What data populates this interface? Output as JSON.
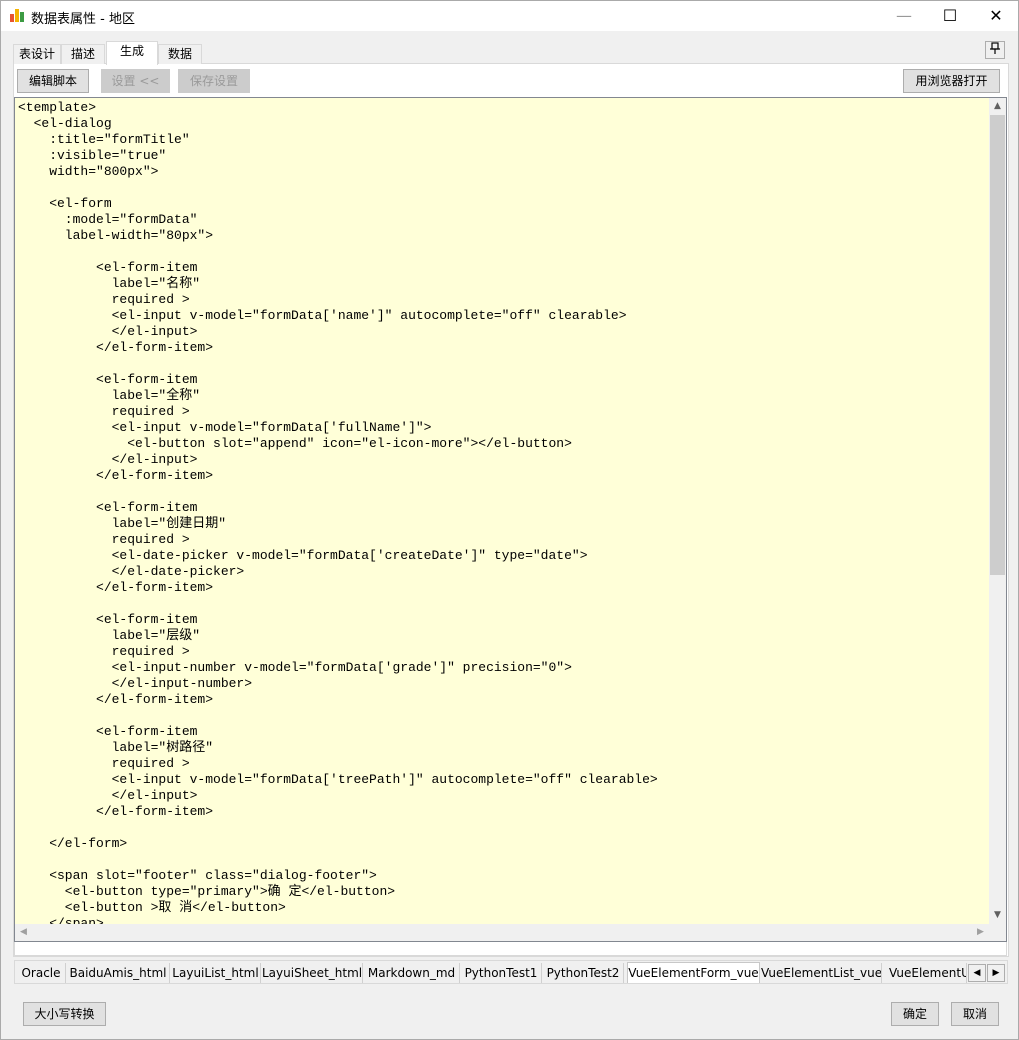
{
  "window": {
    "title": "数据表属性 - 地区",
    "controls": {
      "minimize": "—",
      "maximize": "☐",
      "close": "✕"
    }
  },
  "top_tabs": [
    {
      "label": "表设计",
      "active": false
    },
    {
      "label": "描述",
      "active": false
    },
    {
      "label": "生成",
      "active": true
    },
    {
      "label": "数据",
      "active": false
    }
  ],
  "pin_icon": "pin-icon",
  "toolbar": {
    "edit_script": "编辑脚本",
    "settings": "设置 <<",
    "save_settings": "保存设置",
    "open_in_browser": "用浏览器打开"
  },
  "editor": {
    "background": "#ffffd8",
    "lines": [
      "<template>",
      "  <el-dialog",
      "    :title=\"formTitle\"",
      "    :visible=\"true\"",
      "    width=\"800px\">",
      "",
      "    <el-form",
      "      :model=\"formData\"",
      "      label-width=\"80px\">",
      "",
      "          <el-form-item",
      "            label=\"名称\"",
      "            required >",
      "            <el-input v-model=\"formData['name']\" autocomplete=\"off\" clearable>",
      "            </el-input>",
      "          </el-form-item>",
      "",
      "          <el-form-item",
      "            label=\"全称\"",
      "            required >",
      "            <el-input v-model=\"formData['fullName']\">",
      "              <el-button slot=\"append\" icon=\"el-icon-more\"></el-button>",
      "            </el-input>",
      "          </el-form-item>",
      "",
      "          <el-form-item",
      "            label=\"创建日期\"",
      "            required >",
      "            <el-date-picker v-model=\"formData['createDate']\" type=\"date\">",
      "            </el-date-picker>",
      "          </el-form-item>",
      "",
      "          <el-form-item",
      "            label=\"层级\"",
      "            required >",
      "            <el-input-number v-model=\"formData['grade']\" precision=\"0\">",
      "            </el-input-number>",
      "          </el-form-item>",
      "",
      "          <el-form-item",
      "            label=\"树路径\"",
      "            required >",
      "            <el-input v-model=\"formData['treePath']\" autocomplete=\"off\" clearable>",
      "            </el-input>",
      "          </el-form-item>",
      "",
      "    </el-form>",
      "",
      "    <span slot=\"footer\" class=\"dialog-footer\">",
      "      <el-button type=\"primary\">确 定</el-button>",
      "      <el-button >取 消</el-button>",
      "    </span>"
    ]
  },
  "bottom_tabs": [
    {
      "label": "Oracle",
      "active": false
    },
    {
      "label": "BaiduAmis_html",
      "active": false
    },
    {
      "label": "LayuiList_html",
      "active": false
    },
    {
      "label": "LayuiSheet_html",
      "active": false
    },
    {
      "label": "Markdown_md",
      "active": false
    },
    {
      "label": "PythonTest1",
      "active": false
    },
    {
      "label": "PythonTest2",
      "active": false
    },
    {
      "label": "VueElementForm_vue",
      "active": true
    },
    {
      "label": "VueElementList_vue",
      "active": false
    },
    {
      "label": "VueElementU",
      "active": false
    }
  ],
  "footer": {
    "case_convert": "大小写转换",
    "ok": "确定",
    "cancel": "取消"
  }
}
